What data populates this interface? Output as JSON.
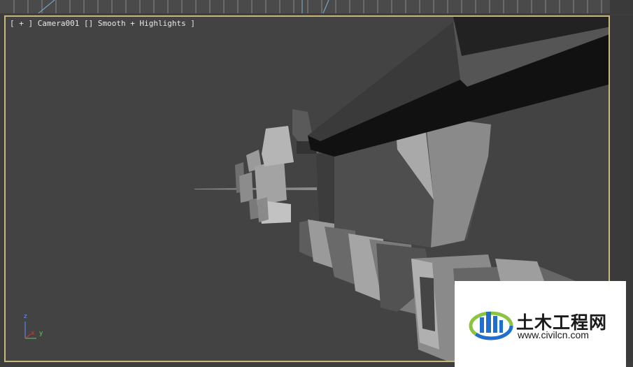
{
  "viewport": {
    "label_parts": [
      "[ ",
      "+",
      " ] ",
      "Camera001",
      " [] ",
      "Smooth + Highlights",
      " ]"
    ],
    "axis": {
      "z": "z",
      "x": "x",
      "y": "y"
    }
  },
  "watermark": {
    "title": "土木工程网",
    "url": "www.civilcn.com"
  },
  "colors": {
    "viewport_border": "#c8b97a",
    "background": "#434343",
    "axis_x": "#e33333",
    "axis_y": "#5cc95c",
    "axis_z": "#6a8cff",
    "logo_blue": "#1f6fd1",
    "logo_green": "#8bc43f"
  }
}
